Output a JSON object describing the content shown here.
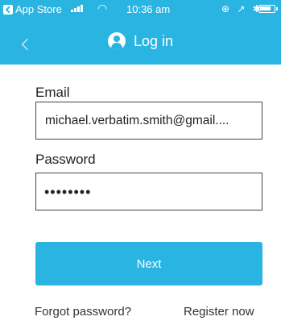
{
  "status_bar": {
    "back_app": "App Store",
    "time": "10:36 am",
    "right_icons": "⊕ ↗ ✱",
    "signal_icon": "signal-bars",
    "wifi_icon": "wifi"
  },
  "nav": {
    "title": "Log in",
    "back_icon": "chevron-left",
    "title_icon": "user-circle"
  },
  "form": {
    "email_label": "Email",
    "email_value": "michael.verbatim.smith@gmail....",
    "password_label": "Password",
    "password_value": "••••••••",
    "next_label": "Next"
  },
  "links": {
    "forgot": "Forgot password?",
    "register": "Register now"
  },
  "colors": {
    "accent": "#2ab4e2",
    "text": "#1f1f1f",
    "field_border": "#444444"
  }
}
